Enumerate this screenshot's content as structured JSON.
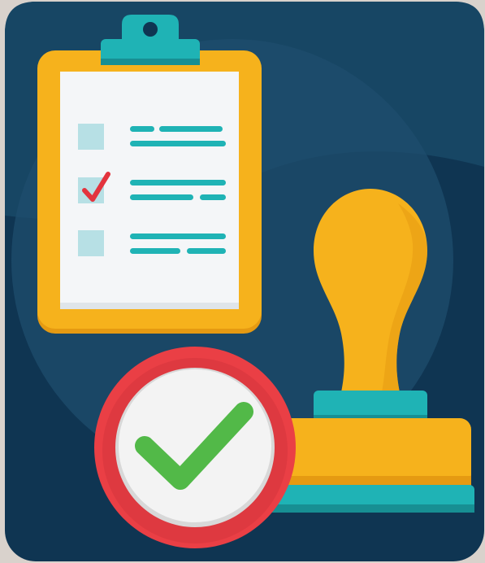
{
  "illustration": {
    "subject": "approval-checklist-illustration",
    "colors": {
      "page_background": "#d9d2cc",
      "panel_background": "#0f3552",
      "panel_highlight": "#1b4b6c",
      "panel_circle": "#21506f",
      "clipboard_board": "#f6b21c",
      "clipboard_board_dark": "#e59a12",
      "clipboard_clip": "#1fb3b5",
      "paper": "#f4f6f8",
      "checkbox": "#b7e0e5",
      "list_lines": "#1fb3b5",
      "small_check": "#e3343e",
      "stamp_handle": "#f6b21c",
      "stamp_collar": "#1fb3b5",
      "stamp_base": "#f6b21c",
      "stamp_plate": "#1fb3b5",
      "badge_ring": "#ea3f45",
      "badge_inner": "#f3f3f3",
      "big_check": "#52b948"
    },
    "icons": [
      "clipboard-icon",
      "checkbox-empty-icon",
      "checkbox-checked-icon",
      "rubber-stamp-icon",
      "approved-check-badge-icon"
    ],
    "checklist": {
      "items": [
        {
          "checked": false
        },
        {
          "checked": true
        },
        {
          "checked": false
        }
      ]
    }
  }
}
